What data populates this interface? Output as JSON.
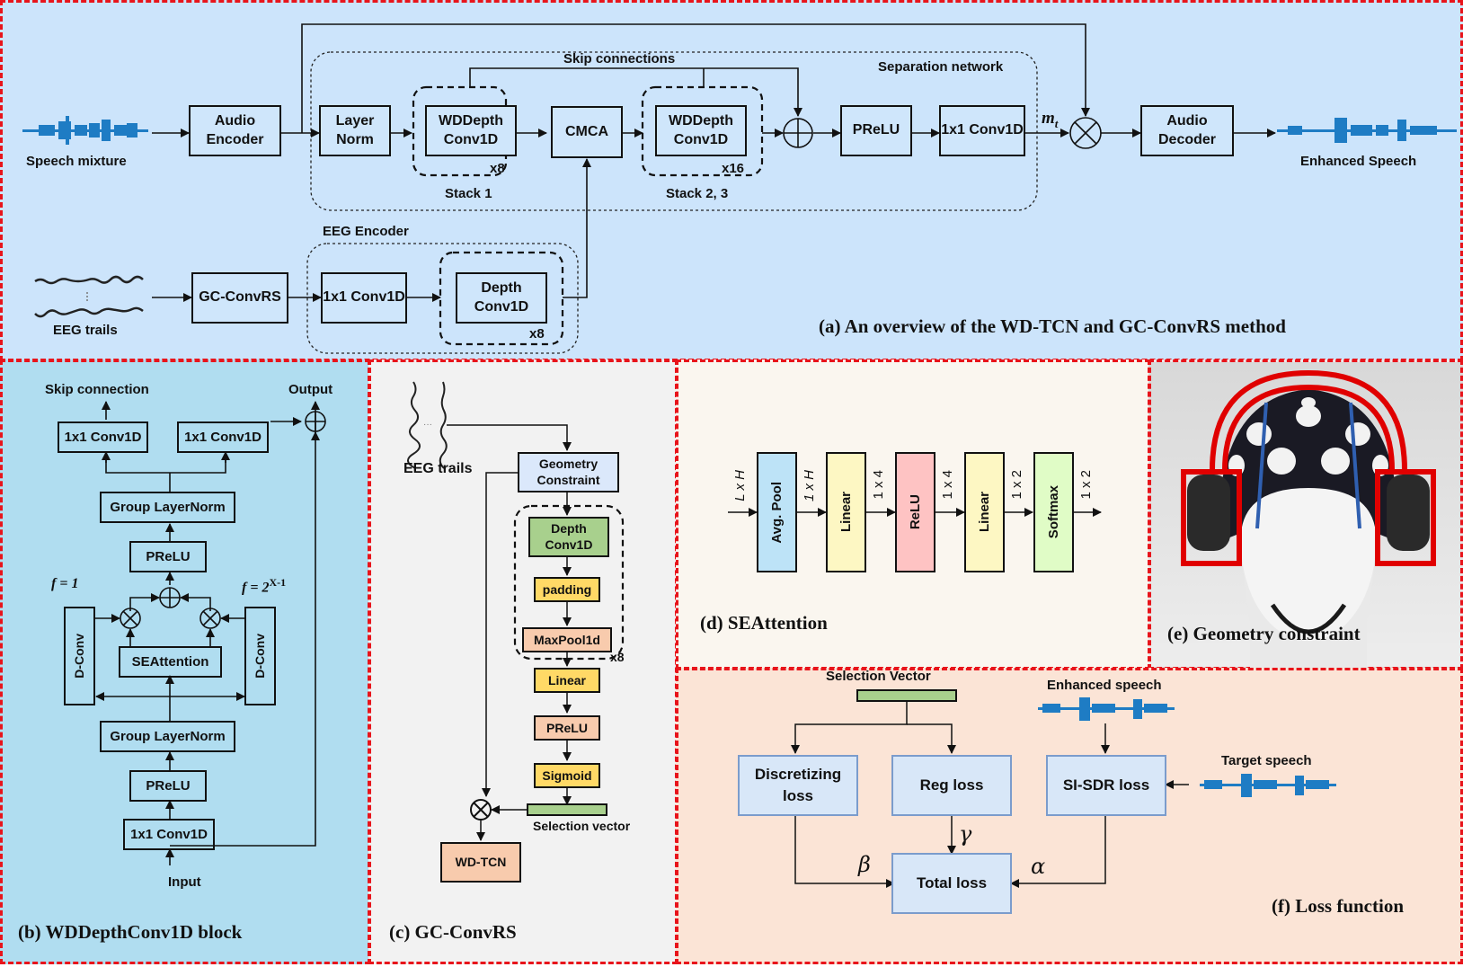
{
  "panel_a": {
    "caption": "(a) An overview of the WD-TCN and GC-ConvRS method",
    "speech_mixture": "Speech mixture",
    "enhanced_speech": "Enhanced Speech",
    "audio_encoder": "Audio Encoder",
    "layer_norm": "Layer Norm",
    "wddepth1": "WDDepth Conv1D",
    "wddepth1_repeat": "x8",
    "stack1": "Stack 1",
    "cmca": "CMCA",
    "wddepth2": "WDDepth Conv1D",
    "wddepth2_repeat": "x16",
    "stack23": "Stack 2, 3",
    "skip_connections": "Skip connections",
    "separation_network": "Separation network",
    "prelu": "PReLU",
    "conv1x1": "1x1 Conv1D",
    "mask_label": "m",
    "mask_sub": "t",
    "audio_decoder": "Audio Decoder",
    "eeg_trails": "EEG trails",
    "gc_convrs": "GC-ConvRS",
    "eeg_encoder": "EEG Encoder",
    "eeg_conv1x1": "1x1 Conv1D",
    "depth_conv": "Depth Conv1D",
    "depth_repeat": "x8"
  },
  "panel_b": {
    "caption": "(b) WDDepthConv1D block",
    "skip_connection": "Skip connection",
    "output": "Output",
    "conv_skip": "1x1 Conv1D",
    "conv_out": "1x1 Conv1D",
    "group_norm_top": "Group LayerNorm",
    "prelu_top": "PReLU",
    "f_left": "f = 1",
    "f_right_base": "f = 2",
    "f_right_exp": "X-1",
    "dconv_left": "D-Conv",
    "dconv_right": "D-Conv",
    "seattention": "SEAttention",
    "group_norm_bottom": "Group LayerNorm",
    "prelu_bottom": "PReLU",
    "conv_in": "1x1 Conv1D",
    "input": "Input"
  },
  "panel_c": {
    "caption": "(c) GC-ConvRS",
    "eeg_trails": "EEG trails",
    "ellipsis": "···",
    "geometry": "Geometry Constraint",
    "depth_conv": "Depth Conv1D",
    "padding": "padding",
    "maxpool": "MaxPool1d",
    "repeat": "x8",
    "linear": "Linear",
    "prelu": "PReLU",
    "sigmoid": "Sigmoid",
    "selection_vector": "Selection vector",
    "wd_tcn": "WD-TCN"
  },
  "panel_d": {
    "caption": "(d) SEAttention",
    "blocks": [
      {
        "label": "Avg. Pool",
        "color": "#bde3f7"
      },
      {
        "label": "Linear",
        "color": "#fdf7c3"
      },
      {
        "label": "ReLU",
        "color": "#fec3c3"
      },
      {
        "label": "Linear",
        "color": "#fdf7c3"
      },
      {
        "label": "Softmax",
        "color": "#e0fcc6"
      }
    ],
    "dims": [
      "L x H",
      "1 x H",
      "1 x 4",
      "1 x 4",
      "1 x 2",
      "1 x 2"
    ]
  },
  "panel_e": {
    "caption": "(e) Geometry constraint"
  },
  "panel_f": {
    "caption": "(f) Loss function",
    "selection_vector": "Selection Vector",
    "enhanced_speech": "Enhanced speech",
    "target_speech": "Target speech",
    "discretizing_loss": "Discretizing loss",
    "reg_loss": "Reg loss",
    "sisdr_loss": "SI-SDR loss",
    "total_loss": "Total loss",
    "beta": "β",
    "gamma": "γ",
    "alpha": "α"
  },
  "colors": {
    "panel_border": "#e8141b",
    "waveform": "#1e7cc4",
    "geometry_red": "#e00000",
    "depth_green": "#a8d08d",
    "yellow": "#ffd966",
    "salmon": "#f8cbad",
    "loss_blue": "#d8e7f8"
  }
}
